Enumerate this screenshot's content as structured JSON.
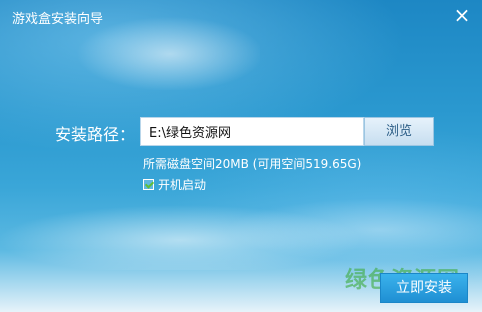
{
  "window": {
    "title": "游戏盒安装向导",
    "close_icon": "×"
  },
  "form": {
    "path_label": "安装路径：",
    "path_value": "E:\\绿色资源网",
    "browse_label": "浏览",
    "space_info": "所需磁盘空间20MB (可用空间519.65G)",
    "autostart_label": "开机启动",
    "autostart_checked": true
  },
  "footer": {
    "install_label": "立即安装",
    "watermark": "绿色资源网"
  },
  "colors": {
    "accent": "#1f8fd3",
    "check": "#5fbf3a"
  }
}
